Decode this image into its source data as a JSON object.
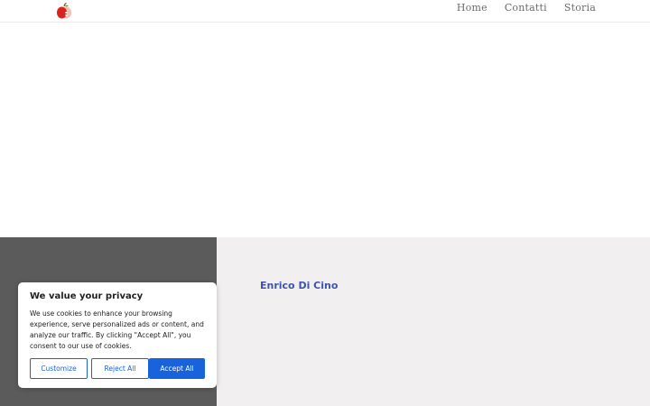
{
  "header": {
    "logo": {
      "icon": "apple-logo-icon"
    },
    "nav": [
      {
        "label": "Home"
      },
      {
        "label": "Contatti"
      },
      {
        "label": "Storia"
      }
    ]
  },
  "main": {
    "person_name": "Enrico Di Cino"
  },
  "cookie_banner": {
    "title": "We value your privacy",
    "text": "We use cookies to enhance your browsing experience, serve personalized ads or content, and analyze our traffic. By clicking \"Accept All\", you consent to our use of cookies.",
    "buttons": {
      "customize": "Customize",
      "reject": "Reject All",
      "accept": "Accept All"
    }
  },
  "colors": {
    "accent": "#1863dc",
    "name_blue": "#3d54a8",
    "dark_panel": "#5b5b5b",
    "light_panel": "#f1eff0"
  }
}
